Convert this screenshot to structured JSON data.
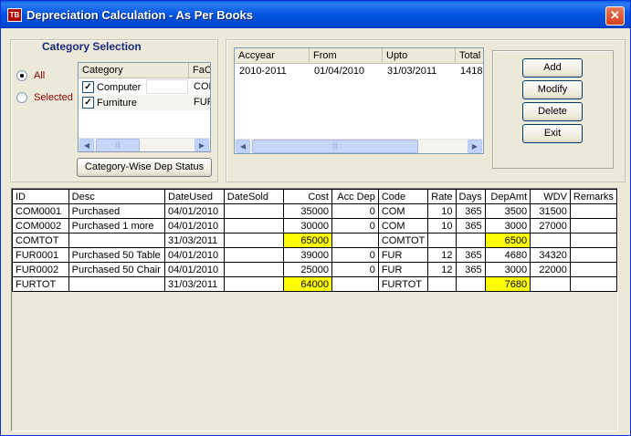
{
  "window": {
    "title": "Depreciation Calculation - As Per Books",
    "icon_text": "TB",
    "close_glyph": "✕"
  },
  "category_selection": {
    "legend": "Category Selection",
    "radio_all": "All",
    "radio_selected": "Selected",
    "selected_option": "All",
    "columns": [
      "Category",
      "FaC"
    ],
    "items": [
      {
        "checked": true,
        "name": "Computer",
        "fac": "COM"
      },
      {
        "checked": true,
        "name": "Furniture",
        "fac": "FUR"
      }
    ],
    "status_button": "Category-Wise Dep Status"
  },
  "year_list": {
    "columns": [
      "Accyear",
      "From",
      "Upto",
      "Total"
    ],
    "rows": [
      {
        "accyear": "2010-2011",
        "from": "01/04/2010",
        "upto": "31/03/2011",
        "total": "1418"
      }
    ]
  },
  "actions": {
    "add": "Add",
    "modify": "Modify",
    "delete": "Delete",
    "exit": "Exit"
  },
  "table": {
    "columns": [
      "ID",
      "Desc",
      "DateUsed",
      "DateSold",
      "Cost",
      "Acc Dep",
      "Code",
      "Rate",
      "Days",
      "DepAmt",
      "WDV",
      "Remarks"
    ],
    "rows": [
      [
        "COM0001",
        "Purchased",
        "04/01/2010",
        "",
        "35000",
        "0",
        "COM",
        "10",
        "365",
        "3500",
        "31500",
        ""
      ],
      [
        "COM0002",
        "Purchased 1 more",
        "04/01/2010",
        "",
        "30000",
        "0",
        "COM",
        "10",
        "365",
        "3000",
        "27000",
        ""
      ],
      [
        "COMTOT",
        "",
        "31/03/2011",
        "",
        "65000",
        "",
        "COMTOT",
        "",
        "",
        "6500",
        "",
        ""
      ],
      [
        "FUR0001",
        "Purchased 50 Table",
        "04/01/2010",
        "",
        "39000",
        "0",
        "FUR",
        "12",
        "365",
        "4680",
        "34320",
        ""
      ],
      [
        "FUR0002",
        "Purchased 50 Chair",
        "04/01/2010",
        "",
        "25000",
        "0",
        "FUR",
        "12",
        "365",
        "3000",
        "22000",
        ""
      ],
      [
        "FURTOT",
        "",
        "31/03/2011",
        "",
        "64000",
        "",
        "FURTOT",
        "",
        "",
        "7680",
        "",
        ""
      ]
    ],
    "highlight_color": "#ffff00"
  },
  "colors": {
    "titlebar": "#0053e1",
    "window_bg": "#ece9d8",
    "legend_text": "#1a2a7c",
    "radio_text": "#8b0000"
  }
}
